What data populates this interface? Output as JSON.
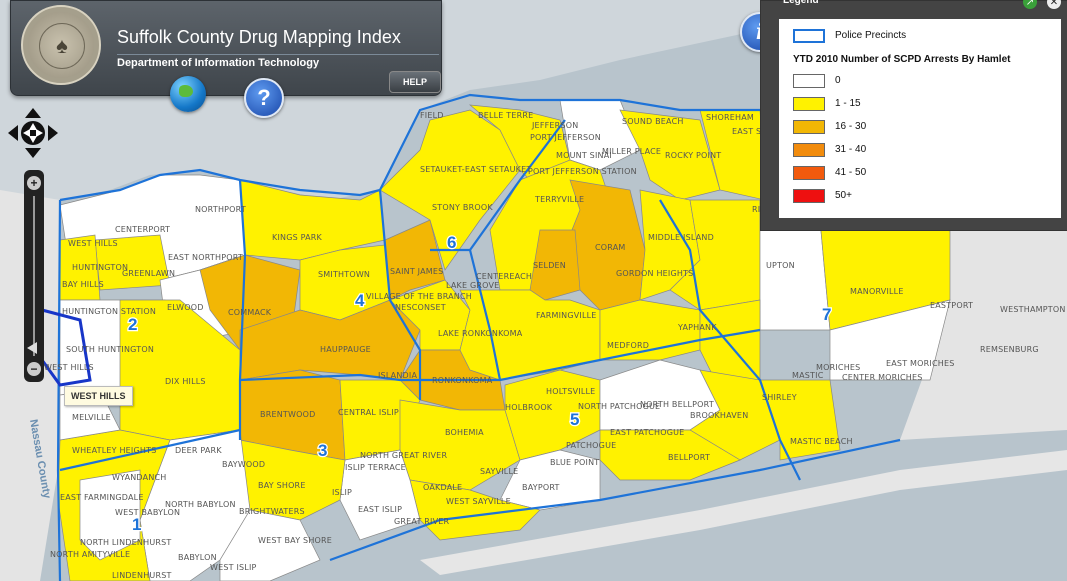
{
  "header": {
    "title": "Suffolk County Drug Mapping Index",
    "subtitle": "Department of Information Technology",
    "help_label": "HELP",
    "seal_text": "SUFFOLK COUNTY SEAL NEW YORK"
  },
  "colors": {
    "class_0": "#ffffff",
    "class_1_15": "#fff200",
    "class_16_30": "#f2b705",
    "class_31_40": "#f28c0d",
    "class_41_50": "#f25a0d",
    "class_50_plus": "#ee1010",
    "precinct_line": "#1e73d8",
    "water": "#b8c4cc",
    "land_outside": "#e4e4e4"
  },
  "legend": {
    "header": "Legend",
    "precinct_label": "Police Precincts",
    "title": "YTD 2010 Number of SCPD Arrests By Hamlet",
    "classes": [
      {
        "label": "0",
        "color": "#ffffff"
      },
      {
        "label": "1 - 15",
        "color": "#fff200"
      },
      {
        "label": "16 - 30",
        "color": "#f2b705"
      },
      {
        "label": "31 - 40",
        "color": "#f28c0d"
      },
      {
        "label": "41 - 50",
        "color": "#f25a0d"
      },
      {
        "label": "50+",
        "color": "#ee1010"
      }
    ]
  },
  "tooltip": "WEST HILLS",
  "county_label": "Nassau County",
  "precinct_numbers": [
    "1",
    "2",
    "3",
    "4",
    "5",
    "6",
    "7"
  ],
  "hamlets": [
    "BELLE TERRE",
    "PORT JEFFERSON",
    "SOUND BEACH",
    "SHOREHAM",
    "EAST SHORE",
    "MOUNT SINAI",
    "MILLER PLACE",
    "ROCKY POINT",
    "SETAUKET-EAST SETAUKET",
    "PORT JEFFERSON STATION",
    "STONY BROOK",
    "TERRYVILLE",
    "NORTHPORT",
    "CENTERPORT",
    "EAST NORTHPORT",
    "KINGS PARK",
    "HUNTINGTON",
    "GREENLAWN",
    "SMITHTOWN",
    "SAINT JAMES",
    "CORAM",
    "MIDDLE ISLAND",
    "SELDEN",
    "CENTEREACH",
    "GORDON HEIGHTS",
    "UPTON",
    "MANORVILLE",
    "ELWOOD",
    "COMMACK",
    "HUNTINGTON STATION",
    "VILLAGE OF THE BRANCH",
    "LAKE GROVE",
    "NESCONSET",
    "FARMINGVILLE",
    "YAPHANK",
    "SOUTH HUNTINGTON",
    "WEST HILLS",
    "HAUPPAUGE",
    "LAKE RONKONKOMA",
    "DIX HILLS",
    "ISLANDIA",
    "RONKONKOMA",
    "MEDFORD",
    "HOLTSVILLE",
    "MELVILLE",
    "BRENTWOOD",
    "CENTRAL ISLIP",
    "HOLBROOK",
    "NORTH PATCHOGUE",
    "NORTH BELLPORT",
    "BROOKHAVEN",
    "SHIRLEY",
    "BOHEMIA",
    "PATCHOGUE",
    "EAST PATCHOGUE",
    "NORTH GREAT RIVER",
    "ISLIP TERRACE",
    "WHEATLEY HEIGHTS",
    "DEER PARK",
    "BAYWOOD",
    "WYANDANCH",
    "BAY SHORE",
    "EAST FARMINGDALE",
    "NORTH BABYLON",
    "WEST BABYLON",
    "ISLIP",
    "EAST ISLIP",
    "SAYVILLE",
    "BLUE POINT",
    "BELLPORT",
    "MASTIC",
    "MASTIC BEACH",
    "OAKDALE",
    "WEST SAYVILLE",
    "BAYPORT",
    "BRIGHTWATERS",
    "WEST BAY SHORE",
    "GREAT RIVER",
    "NORTH LINDENHURST",
    "NORTH AMITYVILLE",
    "BABYLON",
    "LINDENHURST",
    "WEST ISLIP",
    "MORICHES",
    "CENTER MORICHES",
    "EAST MORICHES",
    "WESTHAMPTON",
    "EASTPORT",
    "REMSENBURG",
    "FIELD",
    "JEFFERSON",
    "RIDGE",
    "BAY HILLS",
    "WEST HILLS"
  ],
  "icons": {
    "globe": "globe-icon",
    "help": "question-icon",
    "info": "info-icon",
    "pan": "pan-arrows-icon"
  }
}
